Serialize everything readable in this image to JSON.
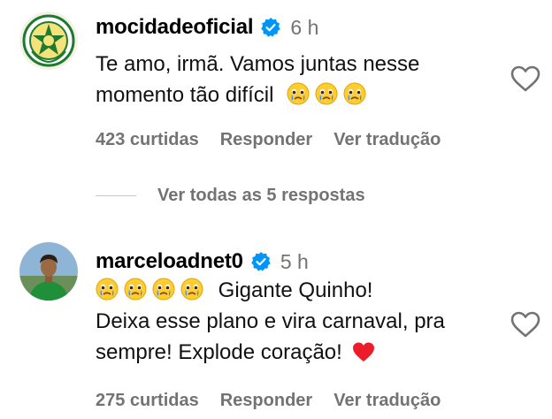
{
  "comments": [
    {
      "username": "mocidadeoficial",
      "time": "6 h",
      "text": "Te amo, irmã. Vamos juntas nesse momento tão difícil",
      "likes": "423 curtidas",
      "reply_label": "Responder",
      "translate_label": "Ver tradução",
      "emoji_count": 3
    },
    {
      "username": "marceloadnet0",
      "time": "5 h",
      "text_line1": "Gigante Quinho!",
      "text_line2": "Deixa esse plano e vira carnaval, pra sempre! Explode coração!",
      "likes": "275 curtidas",
      "reply_label": "Responder",
      "translate_label": "Ver tradução",
      "emoji_count": 4
    }
  ],
  "view_replies_label": "Ver todas as 5 respostas",
  "icons": {
    "verified": "verified-badge-icon",
    "like": "heart-outline-icon",
    "crying": "crying-face-emoji",
    "heart": "red-heart-emoji"
  },
  "colors": {
    "verified_blue": "#0095f6",
    "secondary_text": "#737373",
    "heart_red": "#ed1c2a"
  }
}
